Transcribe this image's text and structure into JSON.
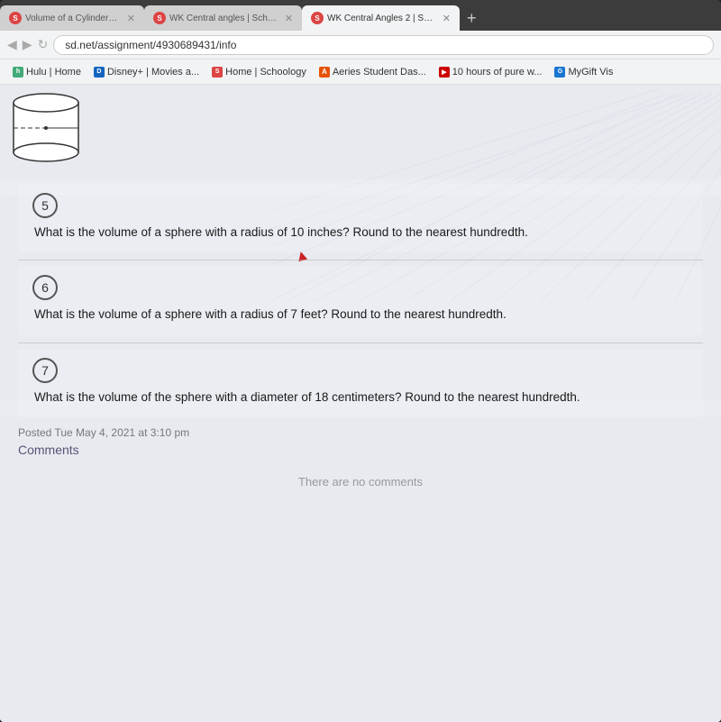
{
  "browser": {
    "tabs": [
      {
        "id": "tab1",
        "favicon_type": "schoology",
        "favicon_letter": "S",
        "label": "Volume of a Cylinder and Sphe",
        "active": false
      },
      {
        "id": "tab2",
        "favicon_type": "schoology",
        "favicon_letter": "S",
        "label": "WK Central angles | Schoology",
        "active": false
      },
      {
        "id": "tab3",
        "favicon_type": "schoology",
        "favicon_letter": "S",
        "label": "WK Central Angles 2 | Schoolo",
        "active": true
      }
    ],
    "address": "sd.net/assignment/4930689431/info"
  },
  "bookmarks": [
    {
      "id": "bm1",
      "color": "#4a7",
      "letter": "h",
      "label": "Hulu | Home"
    },
    {
      "id": "bm2",
      "color": "#1565c0",
      "letter": "D",
      "label": "Disney+ | Movies a..."
    },
    {
      "id": "bm3",
      "color": "#d44",
      "letter": "S",
      "label": "Home | Schoology"
    },
    {
      "id": "bm4",
      "color": "#e65100",
      "letter": "A",
      "label": "Aeries Student Das..."
    },
    {
      "id": "bm5",
      "color": "#c00",
      "letter": "▶",
      "label": "10 hours of pure w..."
    },
    {
      "id": "bm6",
      "color": "#1976d2",
      "letter": "G",
      "label": "MyGift Vis"
    }
  ],
  "questions": [
    {
      "number": "5",
      "text": "What is the volume of a sphere with a radius of 10 inches?  Round to the nearest hundredth."
    },
    {
      "number": "6",
      "text": "What is the volume of a sphere with a radius of 7 feet?  Round to the nearest hundredth."
    },
    {
      "number": "7",
      "text": "What is the volume of the sphere with a diameter of 18 centimeters?  Round to the nearest hundredth."
    }
  ],
  "posted": "Posted Tue May 4, 2021 at 3:10 pm",
  "comments_label": "Comments",
  "no_comments": "There are no comments"
}
